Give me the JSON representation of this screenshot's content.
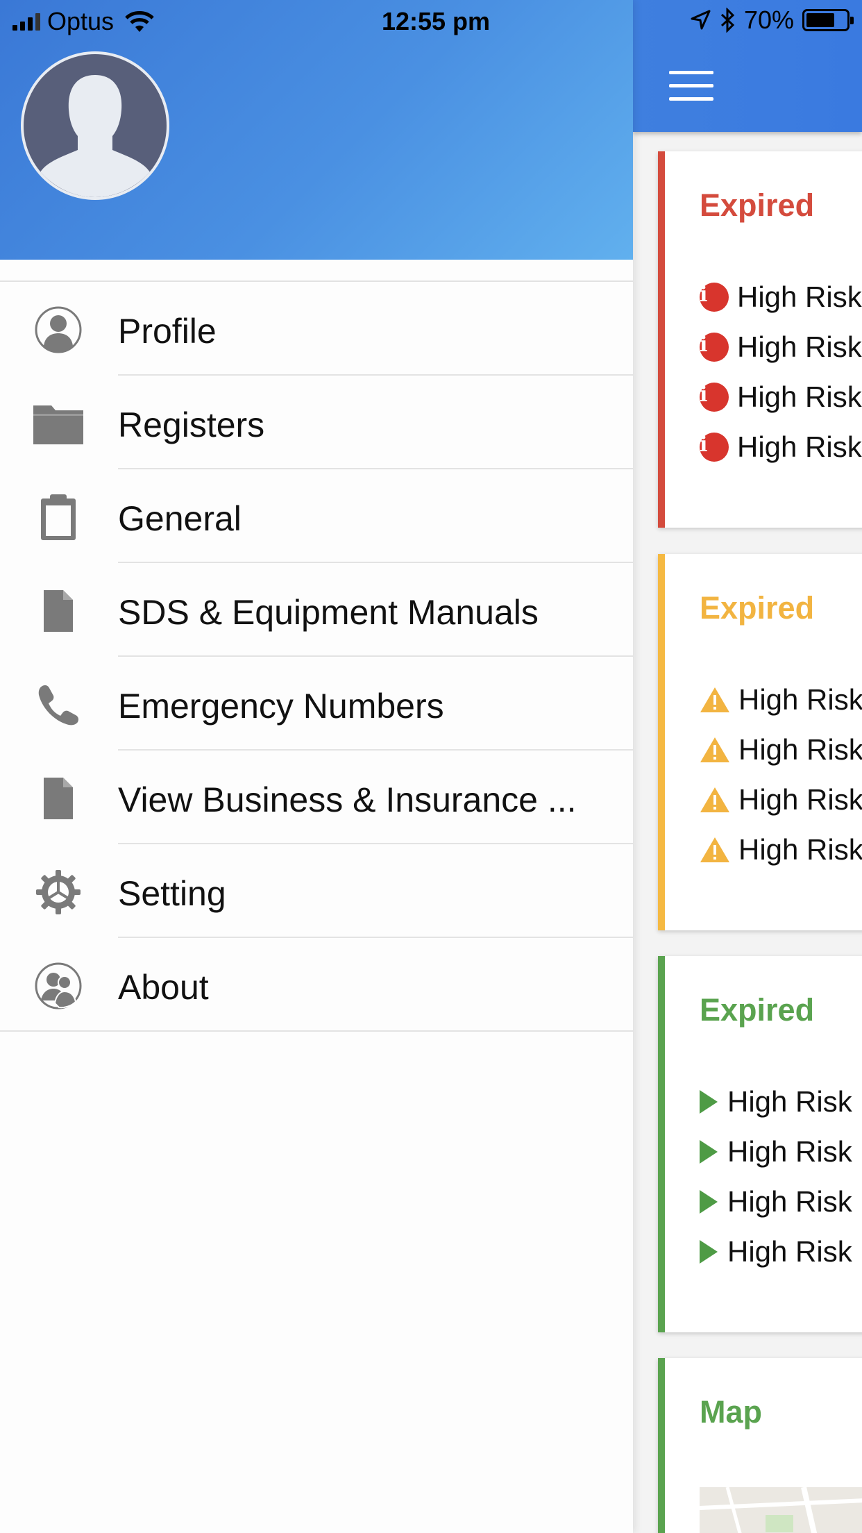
{
  "status_bar": {
    "carrier": "Optus",
    "time": "12:55 pm",
    "battery": "70%"
  },
  "drawer": {
    "avatar_icon": "user-silhouette-icon",
    "menu": [
      {
        "label": "Profile",
        "icon": "user-circle-icon"
      },
      {
        "label": "Registers",
        "icon": "folder-icon"
      },
      {
        "label": "General",
        "icon": "clipboard-icon"
      },
      {
        "label": "SDS & Equipment Manuals",
        "icon": "document-icon"
      },
      {
        "label": "Emergency Numbers",
        "icon": "phone-icon"
      },
      {
        "label": "View Business & Insurance ...",
        "icon": "document-icon"
      },
      {
        "label": "Setting",
        "icon": "gear-icon"
      },
      {
        "label": "About",
        "icon": "users-circle-icon"
      }
    ]
  },
  "app": {
    "header_icon": "hamburger-menu-icon",
    "cards": [
      {
        "title": "Expired",
        "color": "#d44b3d",
        "item_icon": "info-icon",
        "items": [
          "High Risk",
          "High Risk",
          "High Risk",
          "High Risk"
        ]
      },
      {
        "title": "Expired",
        "color": "#f2b441",
        "item_icon": "warning-icon",
        "items": [
          "High Risk",
          "High Risk",
          "High Risk",
          "High Risk"
        ]
      },
      {
        "title": "Expired",
        "color": "#5aa34f",
        "item_icon": "play-icon",
        "items": [
          "High Risk",
          "High Risk",
          "High Risk",
          "High Risk"
        ]
      },
      {
        "title": "Map",
        "color": "#5aa34f"
      }
    ]
  }
}
